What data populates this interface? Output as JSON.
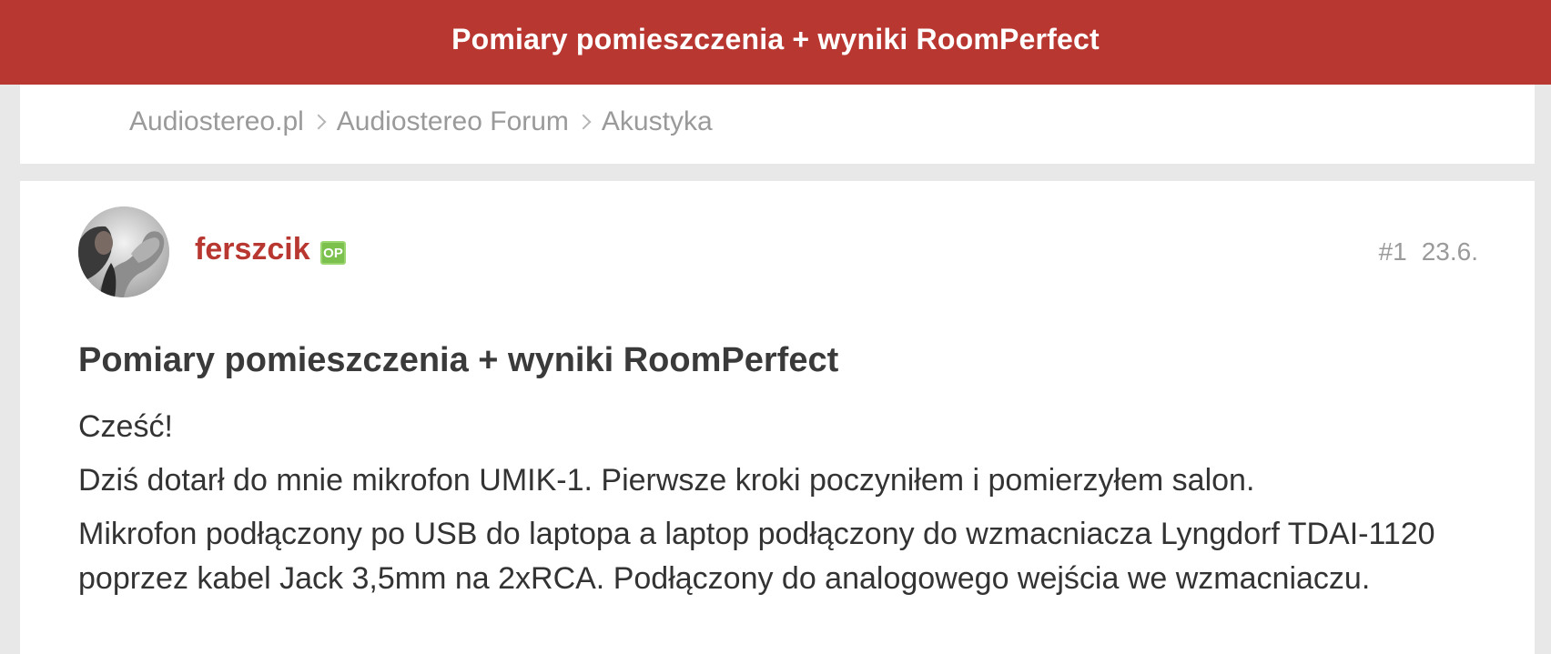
{
  "header": {
    "title": "Pomiary pomieszczenia + wyniki RoomPerfect"
  },
  "breadcrumb": {
    "items": [
      "Audiostereo.pl",
      "Audiostereo Forum",
      "Akustyka"
    ]
  },
  "post": {
    "author": "ferszcik",
    "badge": "OP",
    "number": "#1",
    "date": "23.6.",
    "title": "Pomiary pomieszczenia + wyniki RoomPerfect",
    "paragraphs": [
      "Cześć!",
      "Dziś dotarł do mnie mikrofon UMIK-1. Pierwsze kroki poczyniłem i pomierzyłem salon.",
      "Mikrofon podłączony po USB do laptopa a laptop podłączony do wzmacniacza Lyngdorf TDAI-1120 poprzez kabel Jack 3,5mm na 2xRCA. Podłączony do analogowego wejścia we wzmacniaczu."
    ]
  },
  "colors": {
    "brand": "#b83731",
    "badge": "#7cc04e",
    "muted": "#9a9a9a",
    "background": "#e8e8e8"
  }
}
